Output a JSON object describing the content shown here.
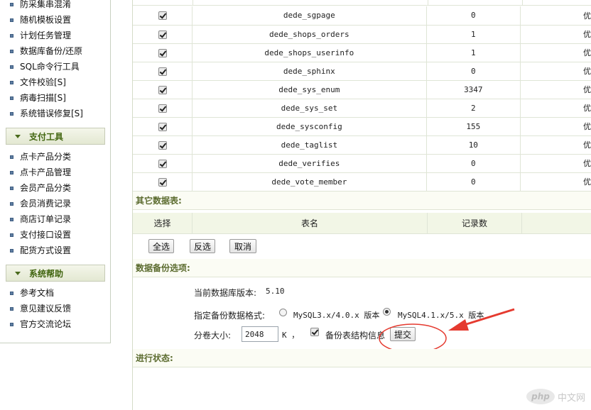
{
  "sidebar": {
    "items_top": [
      "防采集串混淆",
      "随机模板设置",
      "计划任务管理",
      "数据库备份/还原",
      "SQL命令行工具",
      "文件校验[S]",
      "病毒扫描[S]",
      "系统错误修复[S]"
    ],
    "section_pay": "支付工具",
    "items_pay": [
      "点卡产品分类",
      "点卡产品管理",
      "会员产品分类",
      "会员消费记录",
      "商店订单记录",
      "支付接口设置",
      "配货方式设置"
    ],
    "section_help": "系统帮助",
    "items_help": [
      "参考文档",
      "意见建议反馈",
      "官方交流论坛"
    ]
  },
  "tables": [
    {
      "name": "dede_sgpage",
      "count": "0",
      "extra": "优"
    },
    {
      "name": "dede_shops_orders",
      "count": "1",
      "extra": "优"
    },
    {
      "name": "dede_shops_userinfo",
      "count": "1",
      "extra": "优"
    },
    {
      "name": "dede_sphinx",
      "count": "0",
      "extra": "优"
    },
    {
      "name": "dede_sys_enum",
      "count": "3347",
      "extra": "优"
    },
    {
      "name": "dede_sys_set",
      "count": "2",
      "extra": "优"
    },
    {
      "name": "dede_sysconfig",
      "count": "155",
      "extra": "优"
    },
    {
      "name": "dede_taglist",
      "count": "10",
      "extra": "优"
    },
    {
      "name": "dede_verifies",
      "count": "0",
      "extra": "优"
    },
    {
      "name": "dede_vote_member",
      "count": "0",
      "extra": "优"
    }
  ],
  "other_tables": {
    "heading": "其它数据表:",
    "col_select": "选择",
    "col_name": "表名",
    "col_count": "记录数",
    "btn_all": "全选",
    "btn_invert": "反选",
    "btn_cancel": "取消"
  },
  "backup_options": {
    "heading": "数据备份选项:",
    "version_label": "当前数据库版本:",
    "version_value": "5.10",
    "format_label": "指定备份数据格式:",
    "format_opt1": "MySQL3.x/4.0.x 版本",
    "format_opt2": "MySQL4.1.x/5.x 版本",
    "size_label": "分卷大小:",
    "size_value": "2048",
    "size_unit": "K ，",
    "struct_label": "备份表结构信息",
    "submit_label": "提交"
  },
  "status": {
    "heading": "进行状态:"
  },
  "watermark": {
    "logo": "php",
    "text": "中文网"
  },
  "colors": {
    "annotation_red": "#e53a2f",
    "section_green": "#41650f"
  }
}
